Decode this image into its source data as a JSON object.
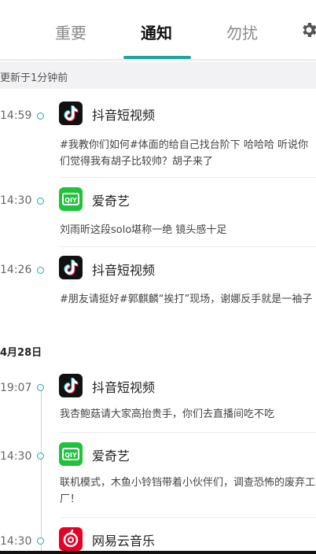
{
  "tabs": [
    {
      "label": "重要",
      "active": false
    },
    {
      "label": "通知",
      "active": true
    },
    {
      "label": "勿扰",
      "active": false
    }
  ],
  "icons": {
    "settings": "gear-icon"
  },
  "updated_text": "更新于1分钟前",
  "date_header": "4月28日",
  "colors": {
    "accent": "#1ea69c",
    "tiktok_bg": "#111111",
    "iqiyi_bg": "#1fc23b",
    "netease_bg": "#e60026"
  },
  "notifications": [
    {
      "time": "14:59",
      "app": "抖音短视频",
      "message": "#我教你们如何#体面的给自己找台阶下 哈哈哈 听说你们觉得我有胡子比较帅？胡子来了"
    },
    {
      "time": "14:30",
      "app": "爱奇艺",
      "message": "刘雨昕这段solo堪称一绝 镜头感十足"
    },
    {
      "time": "14:26",
      "app": "抖音短视频",
      "message": "#朋友请挺好#郭麒麟“挨打”现场，谢娜反手就是一袖子"
    },
    {
      "time": "19:07",
      "app": "抖音短视频",
      "message": "我杏鲍菇请大家高抬贵手，你们去直播间吃不吃"
    },
    {
      "time": "14:30",
      "app": "爱奇艺",
      "message": "联机模式，木鱼小铃铛带着小伙伴们，调查恐怖的废弃工厂！"
    },
    {
      "time": "14:30",
      "app": "网易云音乐",
      "message": ""
    }
  ]
}
